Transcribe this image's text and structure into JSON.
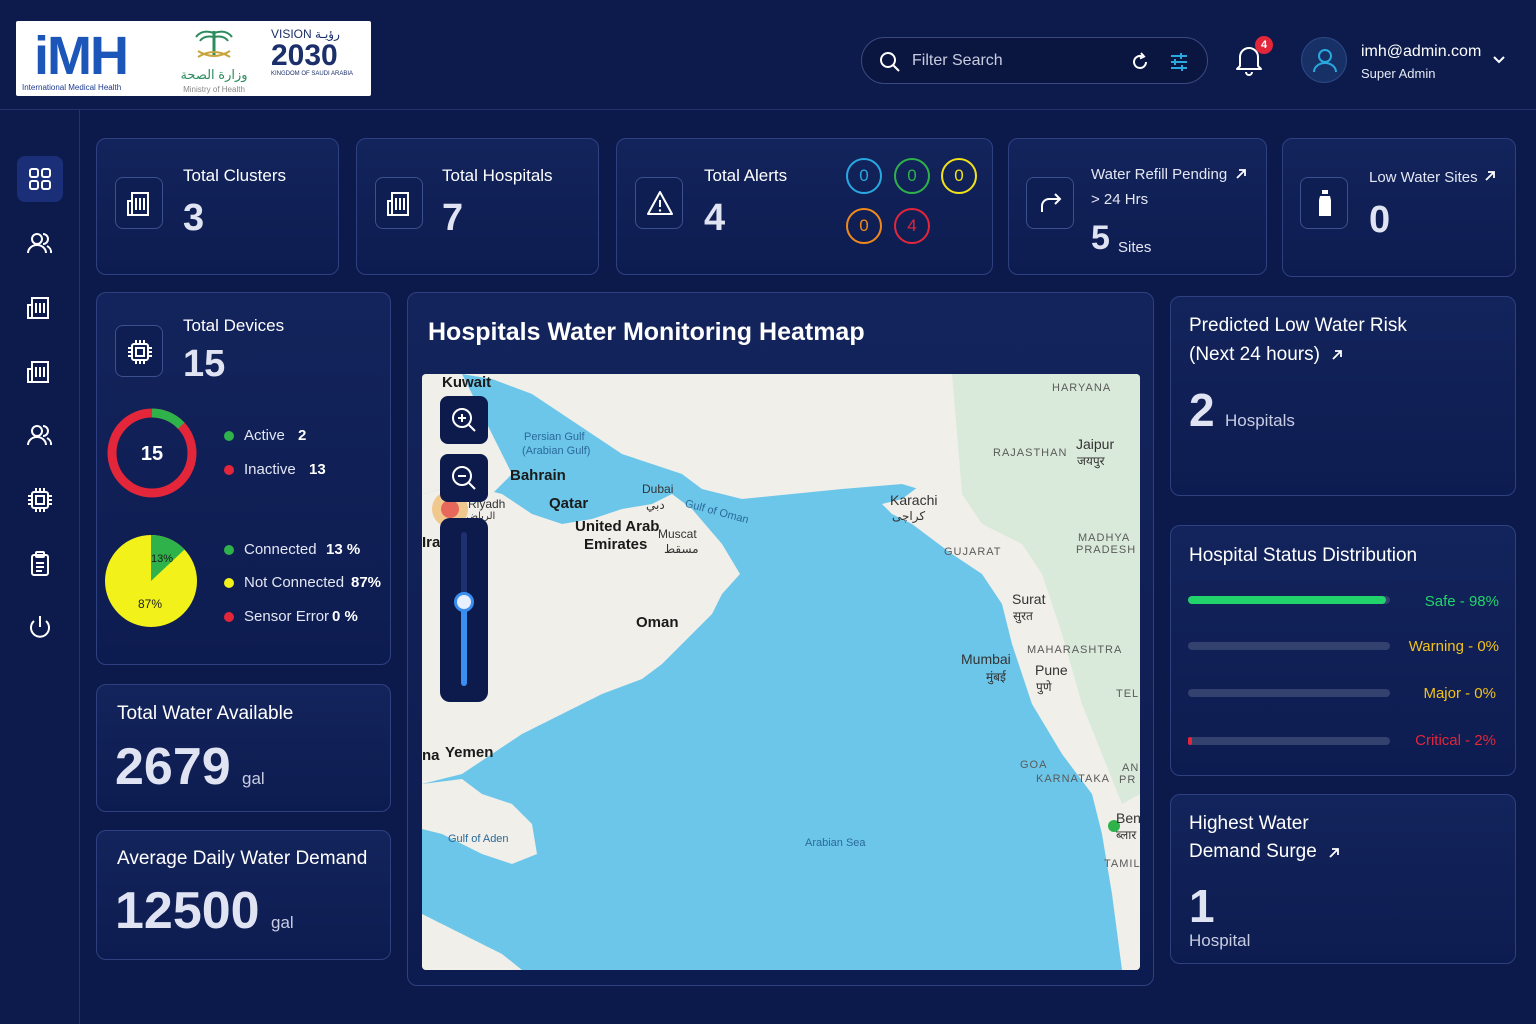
{
  "header": {
    "logo": {
      "imh_text": "iMH",
      "imh_subtitle": "International Medical Health",
      "ministry_arabic": "وزارة الصحة",
      "ministry_english": "Ministry of Health",
      "vision_label": "VISION رؤيـة",
      "vision_year": "2030",
      "vision_sub": "KINGDOM OF SAUDI ARABIA"
    },
    "search": {
      "placeholder": "Filter Search",
      "value": ""
    },
    "notifications": {
      "count": "4"
    },
    "user": {
      "email": "imh@admin.com",
      "role": "Super Admin"
    }
  },
  "sidebar": {
    "items": [
      {
        "icon": "dashboard-grid-icon",
        "active": true
      },
      {
        "icon": "users-icon"
      },
      {
        "icon": "building-icon"
      },
      {
        "icon": "hospital-icon"
      },
      {
        "icon": "team-icon"
      },
      {
        "icon": "device-chip-icon"
      },
      {
        "icon": "clipboard-icon"
      },
      {
        "icon": "power-icon"
      }
    ]
  },
  "stats": {
    "total_clusters": {
      "label": "Total Clusters",
      "value": "3"
    },
    "total_hospitals": {
      "label": "Total Hospitals",
      "value": "7"
    },
    "total_alerts": {
      "label": "Total Alerts",
      "value": "4",
      "badges": [
        {
          "value": "0",
          "color": "#2aa8e0"
        },
        {
          "value": "0",
          "color": "#2fb24a"
        },
        {
          "value": "0",
          "color": "#f2e21a"
        },
        {
          "value": "0",
          "color": "#f08a1c"
        },
        {
          "value": "4",
          "color": "#e3263a"
        }
      ]
    },
    "water_refill": {
      "label": "Water Refill Pending",
      "sub": "> 24 Hrs",
      "value": "5",
      "unit": "Sites"
    },
    "low_water": {
      "label": "Low Water Sites",
      "value": "0"
    }
  },
  "devices": {
    "label": "Total Devices",
    "value": "15",
    "donut_center": "15",
    "active_fraction": 0.13,
    "status_legend": [
      {
        "label": "Active",
        "value": "2",
        "color": "#2fb24a"
      },
      {
        "label": "Inactive",
        "value": "13",
        "color": "#e3263a"
      }
    ],
    "connection_pie": {
      "connected_pct": "13%",
      "not_connected_pct": "87%",
      "connected_fraction": 0.13
    },
    "connection_legend": [
      {
        "label": "Connected",
        "value": "13 %",
        "color": "#2fb24a"
      },
      {
        "label": "Not Connected",
        "value": "87%",
        "color": "#f2f21a"
      },
      {
        "label": "Sensor Error",
        "value": "0 %",
        "color": "#e3263a"
      }
    ]
  },
  "water_available": {
    "label": "Total Water Available",
    "value": "2679",
    "unit": "gal"
  },
  "daily_demand": {
    "label": "Average Daily Water Demand",
    "value": "12500",
    "unit": "gal"
  },
  "heatmap": {
    "title": "Hospitals Water Monitoring Heatmap",
    "labels": {
      "kuwait": "Kuwait",
      "persian_gulf": "Persian Gulf",
      "arabian_gulf": "(Arabian Gulf)",
      "bahrain": "Bahrain",
      "qatar": "Qatar",
      "dubai": "Dubai",
      "dubai_ar": "دبي",
      "gulf_oman": "Gulf of Oman",
      "uae_1": "United Arab",
      "uae_2": "Emirates",
      "muscat": "Muscat",
      "muscat_ar": "مسقط",
      "riyadh": "Riyadh",
      "riyadh_ar": "الرياض",
      "ira": "Ira",
      "oman": "Oman",
      "yemen": "Yemen",
      "sanaa": "na",
      "gulf_aden": "Gulf of Aden",
      "arabian_sea": "Arabian Sea",
      "karachi": "Karachi",
      "karachi_ar": "کراچی",
      "haryana": "HARYANA",
      "rajasthan": "RAJASTHAN",
      "jaipur": "Jaipur",
      "jaipur_hi": "जयपुर",
      "gujarat": "GUJARAT",
      "madhya": "MADHYA",
      "pradesh": "PRADESH",
      "surat": "Surat",
      "surat_hi": "सुरत",
      "maharashtra": "MAHARASHTRA",
      "mumbai": "Mumbai",
      "mumbai_hi": "मुंबई",
      "pune": "Pune",
      "pune_hi": "पुणे",
      "tel": "TELI",
      "goa": "GOA",
      "karnataka": "KARNATAKA",
      "an": "AN",
      "pr": "PR",
      "ben": "Ben",
      "ben_hi": "ब्लार",
      "tamil": "TAMIL"
    }
  },
  "predicted_risk": {
    "label_1": "Predicted Low Water Risk",
    "label_2": "(Next 24 hours)",
    "value": "2",
    "unit": "Hospitals"
  },
  "status_distribution": {
    "title": "Hospital Status Distribution",
    "rows": [
      {
        "label": "Safe - 98%",
        "fraction": 0.98,
        "color": "#22d36b"
      },
      {
        "label": "Warning - 0%",
        "fraction": 0.0,
        "color": "#f2c21a"
      },
      {
        "label": "Major - 0%",
        "fraction": 0.0,
        "color": "#f2c21a"
      },
      {
        "label": "Critical - 2%",
        "fraction": 0.02,
        "color": "#e3263a"
      }
    ]
  },
  "demand_surge": {
    "label_1": "Highest Water",
    "label_2": "Demand Surge",
    "value": "1",
    "unit": "Hospital"
  }
}
